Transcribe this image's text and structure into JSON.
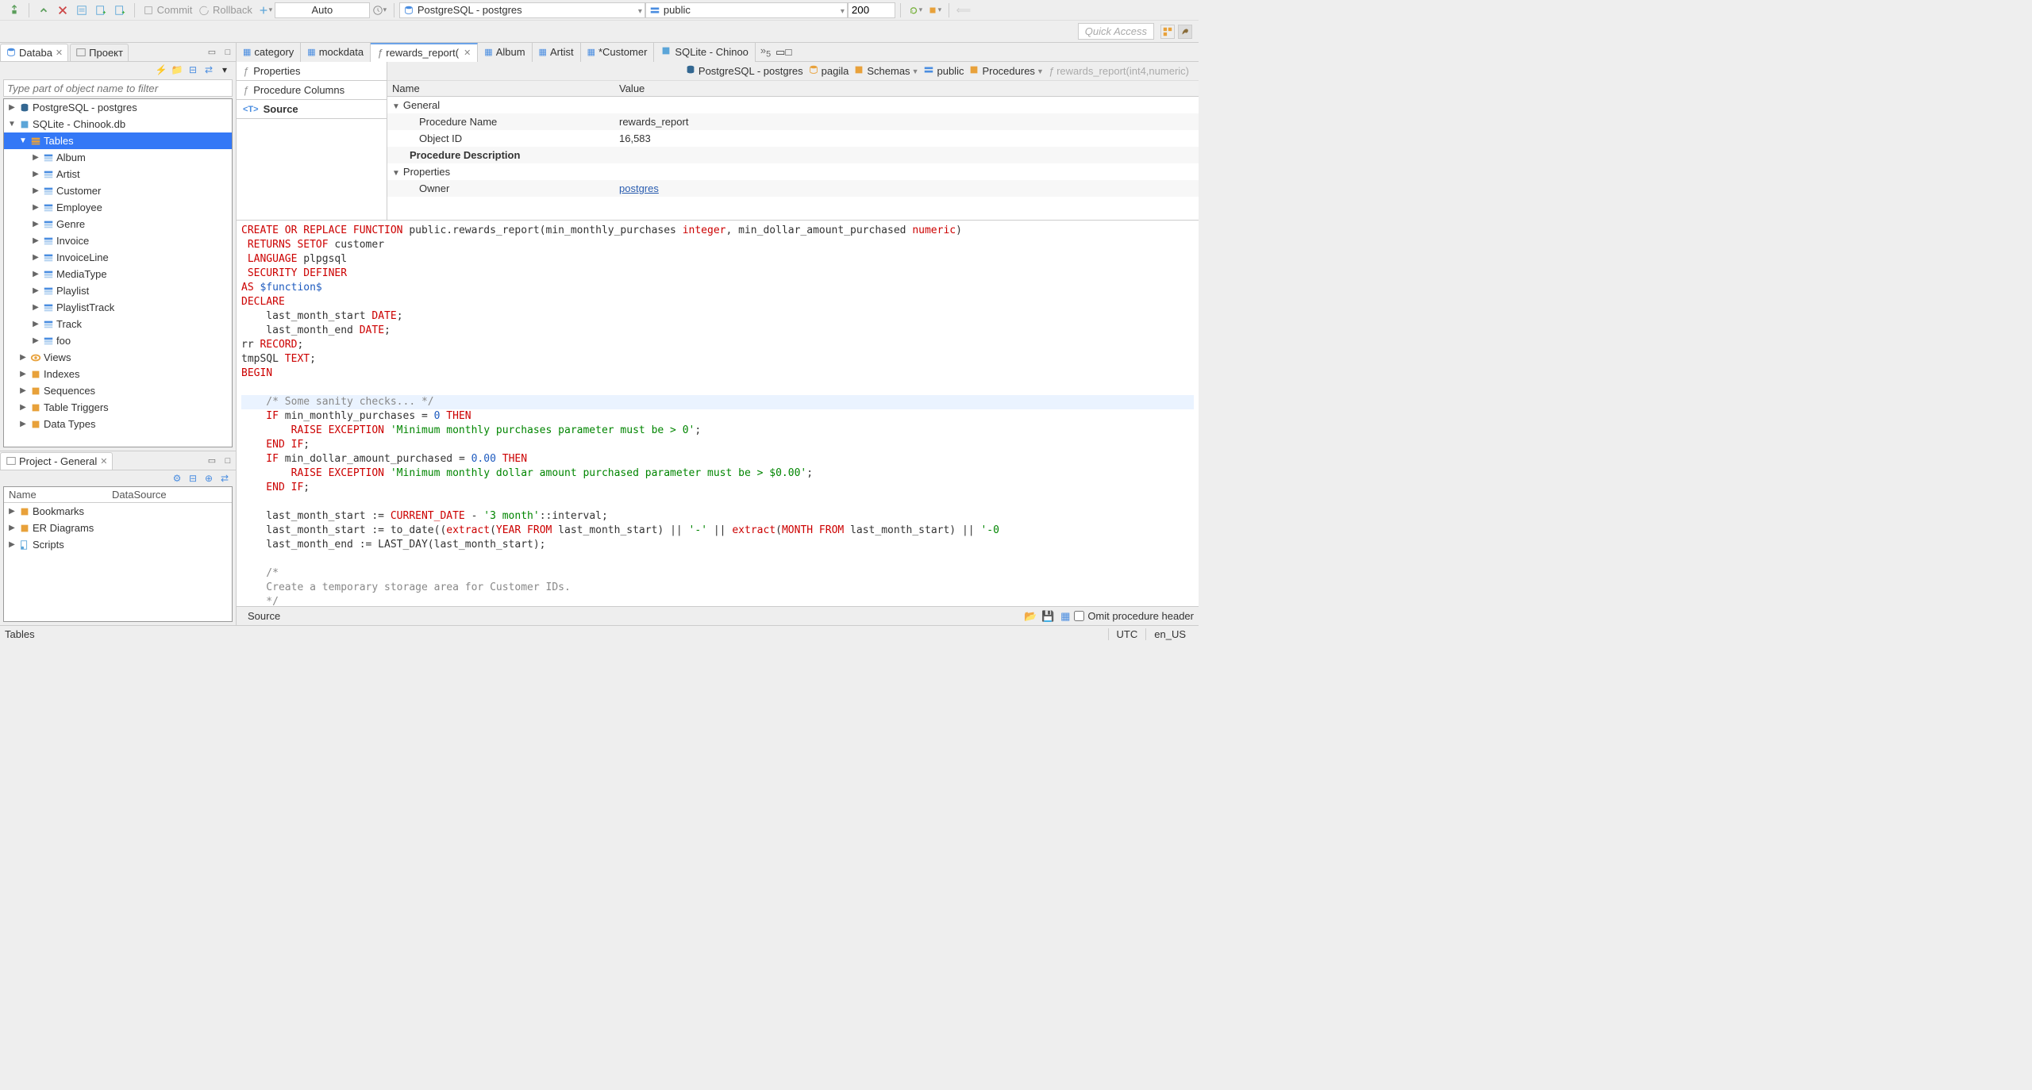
{
  "toolbar": {
    "commit": "Commit",
    "rollback": "Rollback",
    "auto": "Auto",
    "connection": "PostgreSQL - postgres",
    "schema": "public",
    "limit": "200",
    "quick_access": "Quick Access"
  },
  "db_panel": {
    "tab_db": "Databa",
    "tab_project": "Проект",
    "filter_placeholder": "Type part of object name to filter",
    "tree": {
      "pg": "PostgreSQL - postgres",
      "sqlite": "SQLite - Chinook.db",
      "tables": "Tables",
      "album": "Album",
      "artist": "Artist",
      "customer": "Customer",
      "employee": "Employee",
      "genre": "Genre",
      "invoice": "Invoice",
      "invoiceline": "InvoiceLine",
      "mediatype": "MediaType",
      "playlist": "Playlist",
      "playlisttrack": "PlaylistTrack",
      "track": "Track",
      "foo": "foo",
      "views": "Views",
      "indexes": "Indexes",
      "sequences": "Sequences",
      "triggers": "Table Triggers",
      "datatypes": "Data Types"
    }
  },
  "project_panel": {
    "title": "Project - General",
    "col_name": "Name",
    "col_ds": "DataSource",
    "bookmarks": "Bookmarks",
    "er": "ER Diagrams",
    "scripts": "Scripts"
  },
  "editor_tabs": {
    "category": "category",
    "mockdata": "mockdata",
    "rewards": "rewards_report(",
    "album": "Album",
    "artist": "Artist",
    "customer": "*Customer",
    "sqlite": "SQLite - Chinoo",
    "more": "»",
    "more_count": "5"
  },
  "vtabs": {
    "properties": "Properties",
    "columns": "Procedure Columns",
    "source": "Source"
  },
  "breadcrumb": {
    "pg": "PostgreSQL - postgres",
    "pagila": "pagila",
    "schemas": "Schemas",
    "public": "public",
    "procedures": "Procedures",
    "proc": "rewards_report(int4,numeric)"
  },
  "props": {
    "hdr_name": "Name",
    "hdr_value": "Value",
    "general": "General",
    "proc_name_lbl": "Procedure Name",
    "proc_name_val": "rewards_report",
    "objid_lbl": "Object ID",
    "objid_val": "16,583",
    "desc_lbl": "Procedure Description",
    "properties_grp": "Properties",
    "owner_lbl": "Owner",
    "owner_val": "postgres"
  },
  "source": {
    "l1a": "CREATE OR REPLACE FUNCTION",
    "l1b": " public.rewards_report(min_monthly_purchases ",
    "l1c": "integer",
    "l1d": ", min_dollar_amount_purchased ",
    "l1e": "numeric",
    "l1f": ")",
    "l2a": " RETURNS SETOF",
    "l2b": " customer",
    "l3a": " LANGUAGE",
    "l3b": " plpgsql",
    "l4": " SECURITY DEFINER",
    "l5a": "AS",
    "l5b": " $function$",
    "l6": "DECLARE",
    "l7a": "    last_month_start ",
    "l7b": "DATE",
    "l7c": ";",
    "l8a": "    last_month_end ",
    "l8b": "DATE",
    "l8c": ";",
    "l9a": "rr ",
    "l9b": "RECORD",
    "l9c": ";",
    "l10a": "tmpSQL ",
    "l10b": "TEXT",
    "l10c": ";",
    "l11": "BEGIN",
    "blank": "",
    "c1": "    /* Some sanity checks... */",
    "l13a": "    IF",
    "l13b": " min_monthly_purchases = ",
    "l13c": "0",
    "l13d": " THEN",
    "l14a": "        RAISE EXCEPTION ",
    "l14b": "'Minimum monthly purchases parameter must be > 0'",
    "l14c": ";",
    "l15a": "    END",
    "l15b": " IF",
    "l15c": ";",
    "l16a": "    IF",
    "l16b": " min_dollar_amount_purchased = ",
    "l16c": "0.00",
    "l16d": " THEN",
    "l17a": "        RAISE EXCEPTION ",
    "l17b": "'Minimum monthly dollar amount purchased parameter must be > $0.00'",
    "l17c": ";",
    "l18a": "    END",
    "l18b": " IF",
    "l18c": ";",
    "l20a": "    last_month_start := ",
    "l20b": "CURRENT_DATE",
    "l20c": " - ",
    "l20d": "'3 month'",
    "l20e": "::interval;",
    "l21a": "    last_month_start := to_date((",
    "l21b": "extract",
    "l21c": "(",
    "l21d": "YEAR",
    "l21e": " FROM",
    "l21f": " last_month_start) || ",
    "l21g": "'-'",
    "l21h": " || ",
    "l21i": "extract",
    "l21j": "(",
    "l21k": "MONTH",
    "l21l": " FROM",
    "l21m": " last_month_start) || ",
    "l21n": "'-0",
    "l22": "    last_month_end := LAST_DAY(last_month_start);",
    "c2a": "    /*",
    "c2b": "    Create a temporary storage area for Customer IDs.",
    "c2c": "    */"
  },
  "bottom": {
    "source_tab": "Source",
    "omit": "Omit procedure header"
  },
  "status": {
    "tables": "Tables",
    "tz": "UTC",
    "locale": "en_US"
  }
}
